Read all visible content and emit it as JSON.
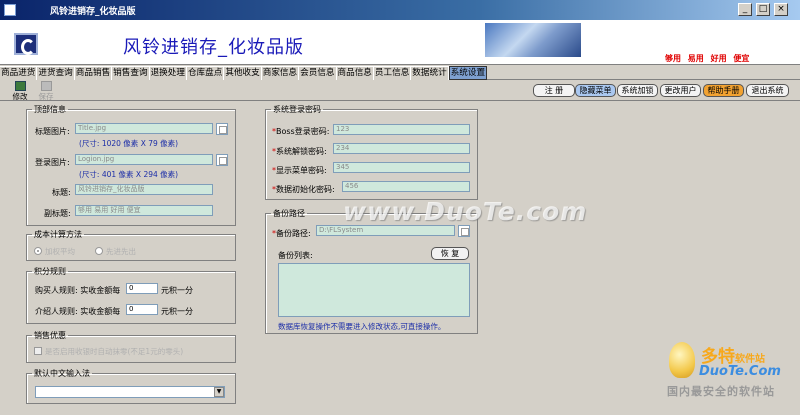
{
  "window": {
    "title": "风铃进销存_化妆品版",
    "controls": [
      "_",
      "□",
      "×"
    ]
  },
  "banner": {
    "title": "风铃进销存_化妆品版",
    "slogan": "够用 易用 好用 便宜"
  },
  "tabs": [
    "商品进货",
    "进货查询",
    "商品销售",
    "销售查询",
    "退换处理",
    "仓库盘点",
    "其他收支",
    "商家信息",
    "会员信息",
    "商品信息",
    "员工信息",
    "数据统计",
    "系统设置"
  ],
  "active_tab": "系统设置",
  "toolbar": {
    "edit": "修改",
    "save": "保存"
  },
  "right_buttons": {
    "register": "注  册",
    "hidden_menu": "隐藏菜单",
    "lock": "系统加锁",
    "change_user": "更改用户",
    "help": "帮助手册",
    "exit": "退出系统"
  },
  "top_info": {
    "legend": "顶部信息",
    "title_img_label": "标题图片:",
    "title_img_value": "Title.jpg",
    "title_img_size": "(尺寸: 1020 像素 X 79 像素)",
    "login_img_label": "登录图片:",
    "login_img_value": "Logion.jpg",
    "login_img_size": "(尺寸: 401 像素 X 294 像素)",
    "title_label": "标题:",
    "title_value": "风铃进销存_化妆品版",
    "subtitle_label": "副标题:",
    "subtitle_value": "够用 易用 好用 便宜"
  },
  "cost": {
    "legend": "成本计算方法",
    "opt1": "加权平均",
    "opt2": "先进先出"
  },
  "points": {
    "legend": "积分规则",
    "buyer_label": "购买人规则: 实收金额每",
    "buyer_value": "0",
    "buyer_unit": "元积一分",
    "ref_label": "介绍人规则: 实收金额每",
    "ref_value": "0",
    "ref_unit": "元积一分"
  },
  "promo": {
    "legend": "销售优惠",
    "text": "是否启用收银时自动抹零(不足1元的零头)"
  },
  "ime": {
    "legend": "默认中文输入法",
    "value": ""
  },
  "passwords": {
    "legend": "系统登录密码",
    "boss_label": "Boss登录密码:",
    "boss_value": "123",
    "unlock_label": "系统解锁密码:",
    "unlock_value": "234",
    "show_menu_label": "显示菜单密码:",
    "show_menu_value": "345",
    "init_label": "数据初始化密码:",
    "init_value": "456"
  },
  "backup": {
    "legend": "备份路径",
    "path_label": "备份路径:",
    "path_value": "D:\\FLSystem",
    "list_label": "备份列表:",
    "restore_btn": "恢 复",
    "note": "数据库恢复操作不需要进入修改状态,可直接操作。"
  },
  "watermark": {
    "main": "www.DuoTe.com",
    "logo_cn": "多特",
    "logo_sub": "软件站",
    "logo_en": "DuoTe.Com",
    "logo_tag": "国内最安全的软件站"
  }
}
